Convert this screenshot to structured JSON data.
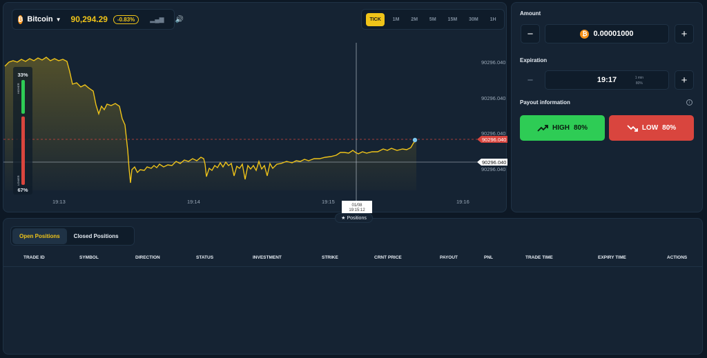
{
  "asset": {
    "coin_symbol": "₿",
    "name": "Bitcoin",
    "price": "90,294.29",
    "change": "-0.83%"
  },
  "timeframes": [
    "TICK",
    "1M",
    "2M",
    "5M",
    "15M",
    "30M",
    "1H"
  ],
  "active_timeframe": "TICK",
  "chart": {
    "price_labels": [
      "90296.040",
      "90296.040",
      "90296.040",
      "90296.040"
    ],
    "badge_red": "90296.040",
    "badge_white": "90296.040",
    "time_labels": [
      "19:13",
      "19:14",
      "19:15",
      "19:16"
    ],
    "higher_pct": "33%",
    "lower_pct": "67%",
    "higher_label": "HIGHER",
    "lower_label": "LOWER",
    "higher_fraction": 0.33,
    "lower_fraction": 0.67,
    "crosshair_date": "01/08",
    "crosshair_time": "19:15:12",
    "line_color": "#f0c419"
  },
  "positions_tag": "Positions",
  "trade": {
    "amount_label": "Amount",
    "amount_value": "0.00001000",
    "expiration_label": "Expiration",
    "expiration_value": "19:17",
    "expiration_sub_1": "1 min",
    "expiration_sub_2": "80%",
    "payout_label": "Payout information",
    "high_label": "HIGH",
    "high_pct": "80%",
    "low_label": "LOW",
    "low_pct": "80%",
    "high_color": "#2ecc55",
    "low_color": "#d9453e"
  },
  "positions": {
    "tabs": [
      "Open Positions",
      "Closed Positions"
    ],
    "active_tab": "Open Positions",
    "columns": [
      "TRADE ID",
      "SYMBOL",
      "DIRECTION",
      "STATUS",
      "INVESTMENT",
      "STRIKE",
      "CRNT PRICE",
      "PAYOUT",
      "PNL",
      "TRADE TIME",
      "EXPIRY TIME",
      "ACTIONS"
    ]
  }
}
